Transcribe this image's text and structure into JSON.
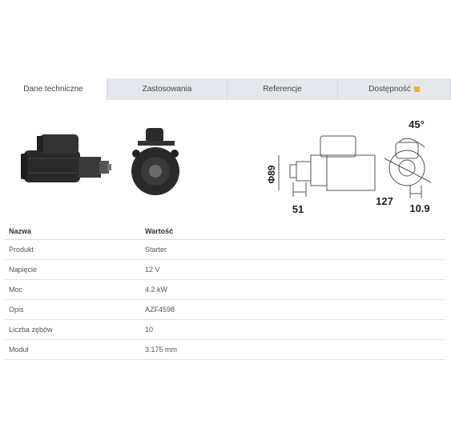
{
  "tabs": [
    {
      "label": "Dane techniczne",
      "active": true
    },
    {
      "label": "Zastosowania",
      "active": false
    },
    {
      "label": "Referencje",
      "active": false
    },
    {
      "label": "Dostępność",
      "active": false
    }
  ],
  "dimensions": {
    "diameter": "Φ89",
    "length": "51",
    "angle": "45°",
    "height": "127",
    "offset": "10.9"
  },
  "table": {
    "header": {
      "name": "Nazwa",
      "value": "Wartość"
    },
    "rows": [
      {
        "name": "Produkt",
        "value": "Starter"
      },
      {
        "name": "Napięcie",
        "value": "12 V"
      },
      {
        "name": "Moc",
        "value": "4.2 kW"
      },
      {
        "name": "Opis",
        "value": "AZF4598"
      },
      {
        "name": "Liczba zębów",
        "value": "10"
      },
      {
        "name": "Moduł",
        "value": "3.175 mm"
      }
    ]
  },
  "colors": {
    "tab_bg": "#e4e8ec",
    "availability": "#f0b429"
  }
}
